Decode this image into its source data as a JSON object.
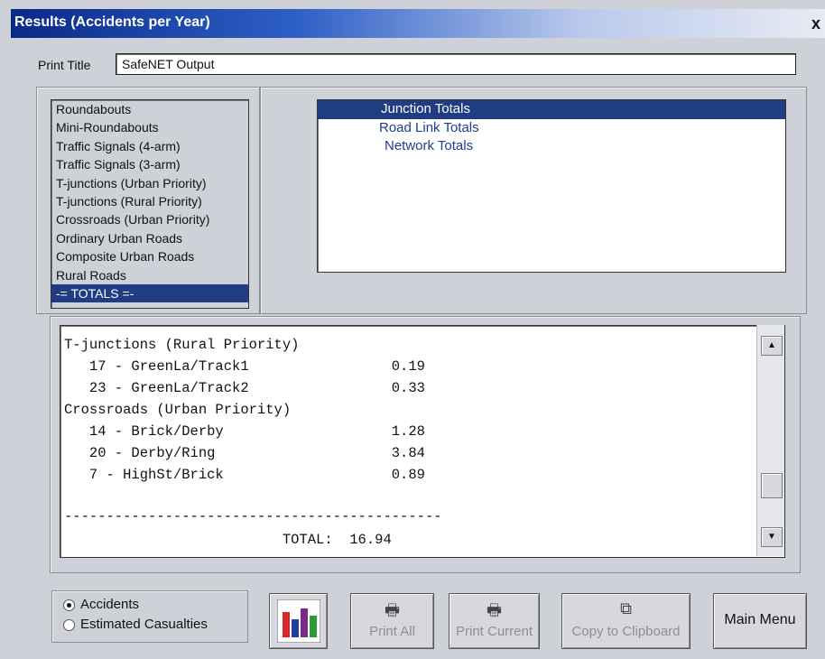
{
  "window": {
    "title": "Results (Accidents per Year)",
    "close_glyph": "x"
  },
  "print_title": {
    "label": "Print Title",
    "value": "SafeNET Output"
  },
  "categories": [
    {
      "label": "Roundabouts",
      "selected": false
    },
    {
      "label": "Mini-Roundabouts",
      "selected": false
    },
    {
      "label": "Traffic Signals (4-arm)",
      "selected": false
    },
    {
      "label": "Traffic Signals (3-arm)",
      "selected": false
    },
    {
      "label": "T-junctions (Urban Priority)",
      "selected": false
    },
    {
      "label": "T-junctions (Rural Priority)",
      "selected": false
    },
    {
      "label": "Crossroads (Urban Priority)",
      "selected": false
    },
    {
      "label": "Ordinary Urban Roads",
      "selected": false
    },
    {
      "label": "Composite Urban Roads",
      "selected": false
    },
    {
      "label": "Rural Roads",
      "selected": false
    },
    {
      "label": "-= TOTALS =-",
      "selected": true
    }
  ],
  "totals_options": [
    {
      "label": "Junction Totals",
      "selected": true
    },
    {
      "label": "Road Link Totals",
      "selected": false
    },
    {
      "label": "Network Totals",
      "selected": false
    }
  ],
  "output": {
    "lines": [
      "T-junctions (Rural Priority)",
      "   17 - GreenLa/Track1                 0.19",
      "   23 - GreenLa/Track2                 0.33",
      "Crossroads (Urban Priority)",
      "   14 - Brick/Derby                    1.28",
      "   20 - Derby/Ring                     3.84",
      "   7 - HighSt/Brick                    0.89",
      "",
      "",
      "---------------------------------------------",
      "                          TOTAL:  16.94"
    ]
  },
  "mode": {
    "accidents_label": "Accidents",
    "casualties_label": "Estimated Casualties",
    "selected": "Accidents"
  },
  "buttons": {
    "print_all": "Print All",
    "print_current": "Print Current",
    "copy": "Copy to Clipboard",
    "main_menu": "Main Menu"
  },
  "colors": {
    "selection": "#203d84",
    "chart_bars": [
      "#d9262b",
      "#1f3f9a",
      "#7a2a8a",
      "#2f9a3a"
    ]
  }
}
